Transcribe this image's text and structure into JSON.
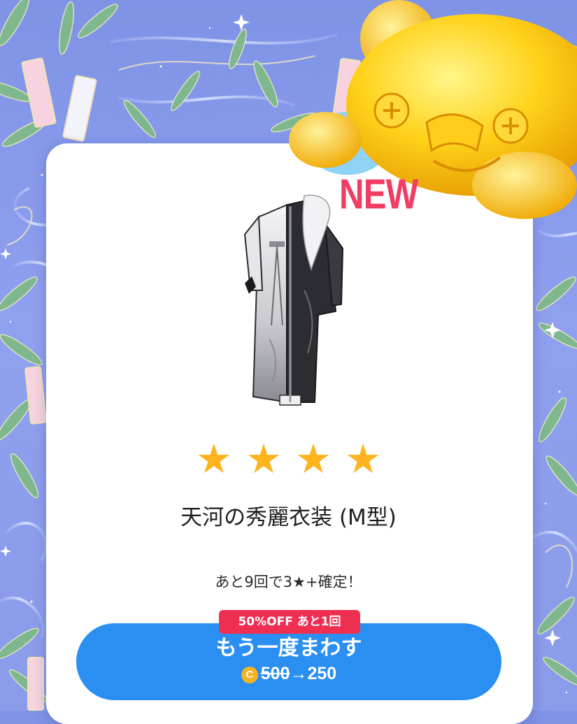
{
  "background": {
    "theme": "tanabata-bamboo-galaxy",
    "base_color": "#8a9ce9"
  },
  "decoration": {
    "mascot": "gold-bear-figure-icon"
  },
  "result_card": {
    "new_label": "NEW",
    "item_icon": "outfit-icon",
    "star_icon": "star-icon",
    "rarity_stars": 4,
    "stars": [
      "★",
      "★",
      "★",
      "★"
    ],
    "item_name": "天河の秀麗衣装 (M型)",
    "guarantee_text": "あと9回で3★+確定！"
  },
  "spin_button": {
    "badge": "50%OFF あと1回",
    "label": "もう一度まわす",
    "coin_symbol": "C",
    "old_price": "500",
    "arrow": "→",
    "new_price": "250"
  },
  "colors": {
    "accent_blue": "#2a8ff0",
    "badge_red": "#ef2f52",
    "new_red": "#f13c63",
    "star_gold": "#ffb41d",
    "coin_gold": "#f6b31f"
  }
}
